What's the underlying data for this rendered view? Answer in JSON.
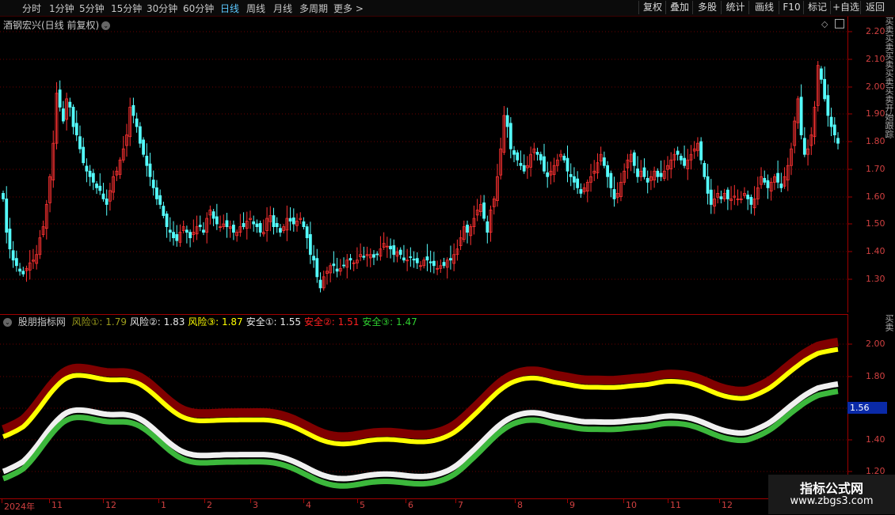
{
  "toolbar": {
    "periods": [
      "分时",
      "1分钟",
      "5分钟",
      "15分钟",
      "30分钟",
      "60分钟",
      "日线",
      "周线",
      "月线",
      "多周期",
      "更多 >"
    ],
    "active_period": "日线",
    "buttons": [
      "复权",
      "叠加",
      "多股",
      "统计",
      "画线",
      "F10",
      "标记",
      "+自选",
      "返回"
    ]
  },
  "main_chart": {
    "title": "酒钢宏兴(日线 前复权)",
    "y_ticks": [
      "2.20",
      "2.10",
      "2.00",
      "1.90",
      "1.80",
      "1.70",
      "1.60",
      "1.50",
      "1.40",
      "1.30"
    ]
  },
  "indicator": {
    "name": "股朋指标网",
    "lines": [
      {
        "label": "风险①:",
        "value": "1.79",
        "color": "#9c9c1c"
      },
      {
        "label": "风险②:",
        "value": "1.83",
        "color": "#e8e8e8"
      },
      {
        "label": "风险③:",
        "value": "1.87",
        "color": "#ffff00"
      },
      {
        "label": "安全①:",
        "value": "1.55",
        "color": "#e8e8e8"
      },
      {
        "label": "安全②:",
        "value": "1.51",
        "color": "#ff2020"
      },
      {
        "label": "安全③:",
        "value": "1.47",
        "color": "#30d030"
      }
    ],
    "y_ticks": [
      "2.00",
      "1.80",
      "1.40",
      "1.20"
    ],
    "price_tag": "1.56"
  },
  "x_axis": {
    "labels": [
      "2024年",
      "11",
      "12",
      "1",
      "2",
      "3",
      "4",
      "5",
      "6",
      "7",
      "8",
      "9",
      "10",
      "11",
      "12"
    ]
  },
  "sidebar_text": "买卖买卖买卖买卖买卖开始跟踪",
  "sidebar_text2": "买卖",
  "watermark": {
    "line1": "指标公式网",
    "line2": "www.zbgs3.com"
  },
  "colors": {
    "up": "#ff3232",
    "down": "#54fcfc",
    "grid": "#6a0000",
    "risk_band": "#800000",
    "risk_line": "#ffff00",
    "safe_band": "#f0f0f0",
    "safe_line": "#3cb83c"
  },
  "chart_data": {
    "type": "candlestick",
    "title": "酒钢宏兴(日线 前复权)",
    "ylim": [
      1.24,
      2.25
    ],
    "closes": [
      1.62,
      1.5,
      1.44,
      1.4,
      1.38,
      1.36,
      1.35,
      1.37,
      1.39,
      1.4,
      1.42,
      1.48,
      1.52,
      1.6,
      1.7,
      1.82,
      2.0,
      1.95,
      1.9,
      1.98,
      1.95,
      1.88,
      1.85,
      1.8,
      1.75,
      1.72,
      1.7,
      1.68,
      1.66,
      1.65,
      1.62,
      1.6,
      1.65,
      1.7,
      1.72,
      1.76,
      1.8,
      1.85,
      1.95,
      1.92,
      1.88,
      1.82,
      1.78,
      1.74,
      1.7,
      1.66,
      1.62,
      1.6,
      1.56,
      1.52,
      1.5,
      1.48,
      1.47,
      1.5,
      1.52,
      1.5,
      1.48,
      1.5,
      1.52,
      1.52,
      1.5,
      1.55,
      1.58,
      1.55,
      1.53,
      1.52,
      1.53,
      1.52,
      1.52,
      1.5,
      1.5,
      1.52,
      1.52,
      1.54,
      1.55,
      1.53,
      1.52,
      1.5,
      1.5,
      1.55,
      1.56,
      1.52,
      1.52,
      1.5,
      1.52,
      1.55,
      1.54,
      1.53,
      1.54,
      1.55,
      1.52,
      1.48,
      1.42,
      1.4,
      1.34,
      1.3,
      1.34,
      1.36,
      1.38,
      1.38,
      1.36,
      1.37,
      1.38,
      1.4,
      1.4,
      1.39,
      1.4,
      1.42,
      1.41,
      1.42,
      1.42,
      1.41,
      1.42,
      1.44,
      1.46,
      1.45,
      1.44,
      1.42,
      1.43,
      1.42,
      1.4,
      1.4,
      1.41,
      1.4,
      1.39,
      1.38,
      1.4,
      1.4,
      1.39,
      1.38,
      1.37,
      1.38,
      1.38,
      1.4,
      1.4,
      1.42,
      1.44,
      1.48,
      1.52,
      1.5,
      1.52,
      1.55,
      1.58,
      1.6,
      1.55,
      1.5,
      1.58,
      1.62,
      1.7,
      1.8,
      1.92,
      1.88,
      1.8,
      1.78,
      1.76,
      1.74,
      1.72,
      1.74,
      1.78,
      1.8,
      1.78,
      1.76,
      1.72,
      1.7,
      1.72,
      1.74,
      1.76,
      1.78,
      1.76,
      1.72,
      1.7,
      1.68,
      1.66,
      1.64,
      1.66,
      1.68,
      1.7,
      1.72,
      1.75,
      1.78,
      1.74,
      1.7,
      1.66,
      1.62,
      1.64,
      1.68,
      1.72,
      1.76,
      1.78,
      1.74,
      1.7,
      1.72,
      1.7,
      1.68,
      1.7,
      1.72,
      1.7,
      1.7,
      1.72,
      1.74,
      1.76,
      1.78,
      1.78,
      1.76,
      1.74,
      1.76,
      1.78,
      1.8,
      1.82,
      1.76,
      1.7,
      1.64,
      1.6,
      1.62,
      1.64,
      1.62,
      1.64,
      1.62,
      1.62,
      1.63,
      1.62,
      1.62,
      1.64,
      1.62,
      1.6,
      1.62,
      1.66,
      1.7,
      1.68,
      1.66,
      1.68,
      1.7,
      1.68,
      1.66,
      1.7,
      1.74,
      1.8,
      1.9,
      1.98,
      1.85,
      1.78,
      1.8,
      1.85,
      1.95,
      2.1,
      2.05,
      1.98,
      1.92,
      1.88,
      1.85,
      1.82
    ]
  }
}
